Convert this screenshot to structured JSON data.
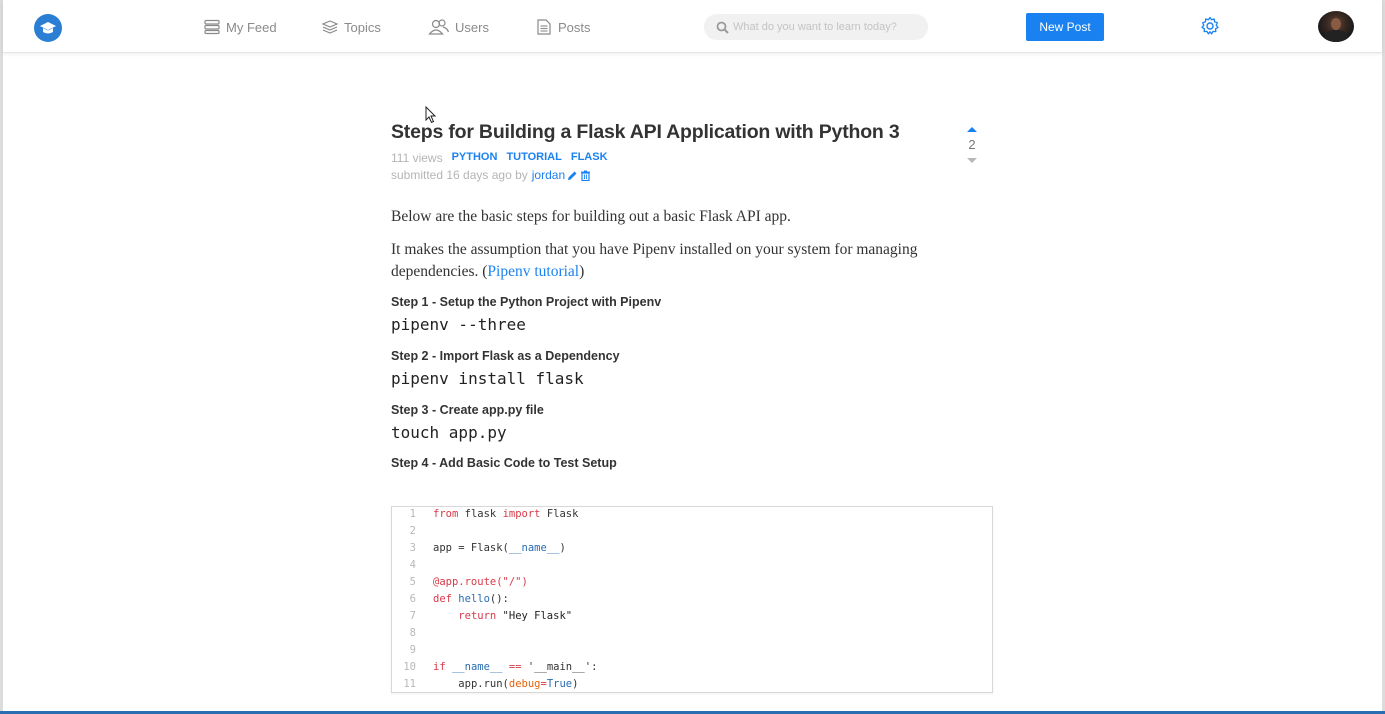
{
  "nav": {
    "items": [
      {
        "label": "My Feed",
        "icon": "feed-icon"
      },
      {
        "label": "Topics",
        "icon": "topics-icon"
      },
      {
        "label": "Users",
        "icon": "users-icon"
      },
      {
        "label": "Posts",
        "icon": "posts-icon"
      }
    ],
    "search_placeholder": "What do you want to learn today?",
    "new_post_label": "New Post"
  },
  "post": {
    "title": "Steps for Building a Flask API Application with Python 3",
    "views": "111 views",
    "tags": [
      "PYTHON",
      "TUTORIAL",
      "FLASK"
    ],
    "submitted": "submitted 16 days ago by",
    "author": "jordan",
    "vote_count": "2",
    "paragraph1": "Below are the basic steps for building out a basic Flask API app.",
    "paragraph2_before": "It makes the assumption that you have Pipenv installed on your system for managing dependencies. (",
    "paragraph2_link": "Pipenv tutorial",
    "paragraph2_after": ")",
    "steps": [
      {
        "heading": "Step 1 - Setup the Python Project with Pipenv",
        "command": "pipenv --three"
      },
      {
        "heading": "Step 2 - Import Flask as a Dependency",
        "command": "pipenv install flask"
      },
      {
        "heading": "Step 3 - Create app.py file",
        "command": "touch app.py"
      },
      {
        "heading": "Step 4 - Add Basic Code to Test Setup",
        "command": ""
      }
    ],
    "code": {
      "line_numbers": [
        "1",
        "2",
        "3",
        "4",
        "5",
        "6",
        "7",
        "8",
        "9",
        "10",
        "11"
      ],
      "l1_kw1": "from",
      "l1_mid": " flask ",
      "l1_kw2": "import",
      "l1_end": " Flask",
      "l3_a": "app = Flask(",
      "l3_b": "__name__",
      "l3_c": ")",
      "l5": "@app.route(\"/\")",
      "l6_kw": "def",
      "l6_fn": " hello",
      "l6_end": "():",
      "l7_kw": "return",
      "l7_str": " \"Hey Flask\"",
      "l10_kw": "if",
      "l10_a": " __name__",
      "l10_b": " == ",
      "l10_c": "'__main__'",
      "l10_d": ":",
      "l11_a": "app.run(",
      "l11_b": "debug",
      "l11_c": "=",
      "l11_d": "True",
      "l11_e": ")"
    }
  },
  "colors": {
    "accent": "#1a82f0"
  }
}
